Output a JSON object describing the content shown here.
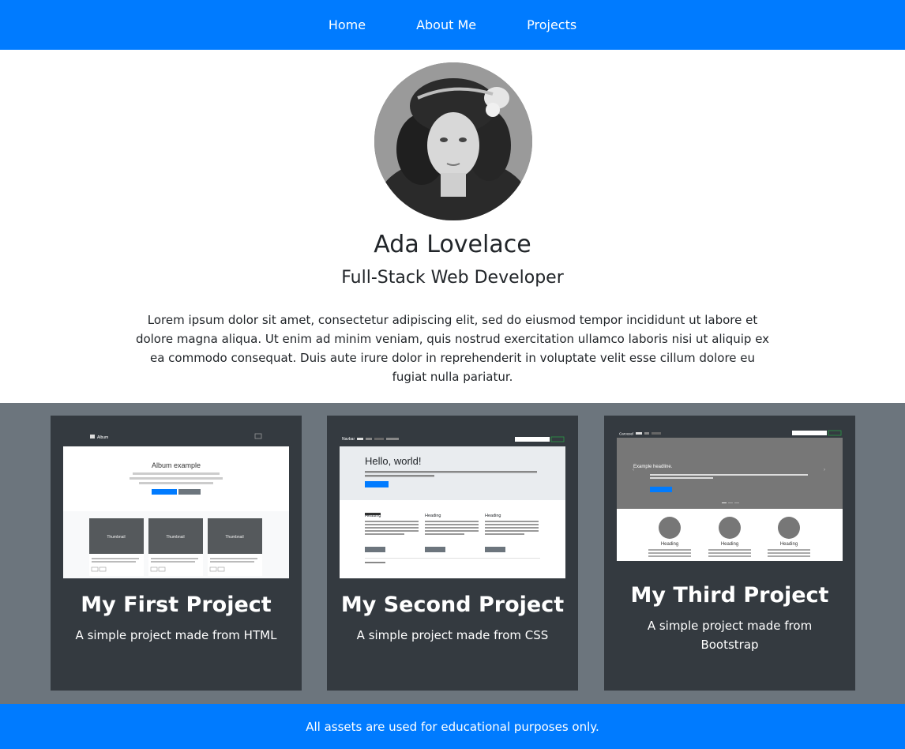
{
  "nav": {
    "items": [
      "Home",
      "About Me",
      "Projects"
    ]
  },
  "profile": {
    "name": "Ada Lovelace",
    "role": "Full-Stack Web Developer",
    "bio": "Lorem ipsum dolor sit amet, consectetur adipiscing elit, sed do eiusmod tempor incididunt ut labore et dolore magna aliqua. Ut enim ad minim veniam, quis nostrud exercitation ullamco laboris nisi ut aliquip ex ea commodo consequat. Duis aute irure dolor in reprehenderit in voluptate velit esse cillum dolore eu fugiat nulla pariatur."
  },
  "projects": [
    {
      "title": "My First Project",
      "description": "A simple project made from HTML",
      "thumb": {
        "brand": "Album",
        "heading": "Album example",
        "tile": "Thumbnail"
      }
    },
    {
      "title": "My Second Project",
      "description": "A simple project made from CSS",
      "thumb": {
        "brand": "Navbar",
        "heading": "Hello, world!",
        "col": "Heading"
      }
    },
    {
      "title": "My Third Project",
      "description": "A simple project made from Bootstrap",
      "thumb": {
        "brand": "Carousel",
        "heading": "Example headline.",
        "col": "Heading"
      }
    }
  ],
  "footer": {
    "text": "All assets are used for educational purposes only."
  },
  "colors": {
    "primary": "#007bff",
    "band": "#6c757d",
    "card": "#343a40"
  }
}
